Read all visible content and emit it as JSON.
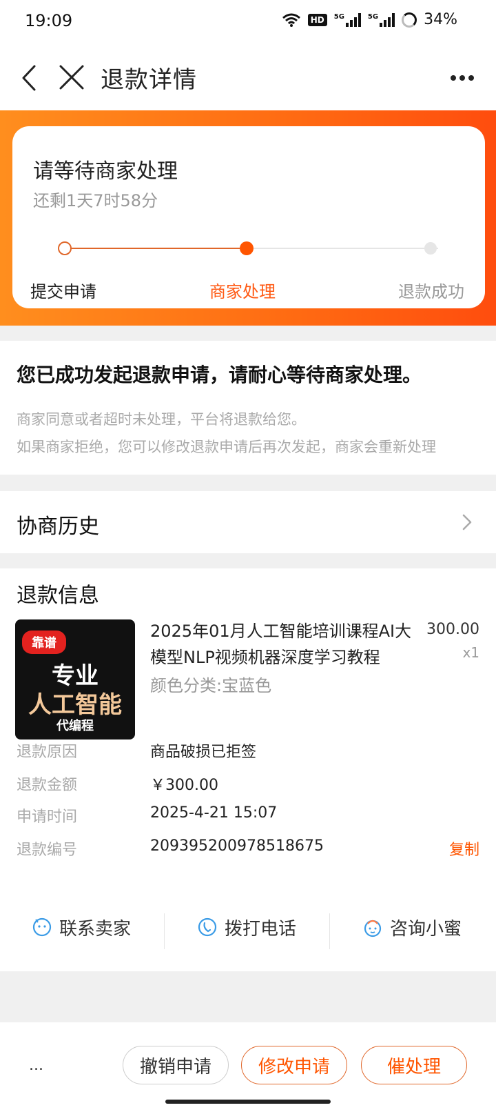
{
  "status_bar": {
    "time": "19:09",
    "hd_label": "HD",
    "network_1": "5G",
    "network_2": "5G",
    "battery": "34%",
    "icons": [
      "wifi-icon",
      "hd-icon",
      "signal-icon",
      "signal-icon",
      "battery-icon"
    ]
  },
  "nav": {
    "title": "退款详情",
    "icons": [
      "back-icon",
      "close-icon",
      "more-icon"
    ]
  },
  "status_card": {
    "title": "请等待商家处理",
    "countdown": "还剩1天7时58分",
    "steps": [
      {
        "label": "提交申请",
        "state": "done"
      },
      {
        "label": "商家处理",
        "state": "current"
      },
      {
        "label": "退款成功",
        "state": "pending"
      }
    ]
  },
  "notice": {
    "headline": "您已成功发起退款申请，请耐心等待商家处理。",
    "line1": "商家同意或者超时未处理，平台将退款给您。",
    "line2": "如果商家拒绝，您可以修改退款申请后再次发起，商家会重新处理"
  },
  "history": {
    "title": "协商历史"
  },
  "refund_info": {
    "title": "退款信息",
    "product": {
      "image_badge": "靠谱",
      "image_line1": "专业",
      "image_line2": "人工智能",
      "image_line3": "代编程",
      "title": "2025年01月人工智能培训课程AI大模型NLP视频机器深度学习教程",
      "spec": "颜色分类:宝蓝色",
      "price": "300.00",
      "qty": "x1"
    },
    "rows": [
      {
        "label": "退款原因",
        "value": "商品破损已拒签"
      },
      {
        "label": "退款金额",
        "value": "￥300.00"
      },
      {
        "label": "申请时间",
        "value": "2025-4-21 15:07"
      },
      {
        "label": "退款编号",
        "value": "209395200978518675"
      }
    ],
    "copy_label": "复制"
  },
  "actions": [
    {
      "label": "联系卖家",
      "icon": "chat-icon"
    },
    {
      "label": "拨打电话",
      "icon": "phone-icon"
    },
    {
      "label": "咨询小蜜",
      "icon": "assistant-icon"
    }
  ],
  "bottom_bar": {
    "more": "...",
    "cancel": "撤销申请",
    "modify": "修改申请",
    "urge": "催处理"
  },
  "colors": {
    "accent": "#ff5500",
    "hero_start": "#ff8e1e",
    "hero_end": "#ff4d0e",
    "action_icon": "#3a9be6"
  }
}
